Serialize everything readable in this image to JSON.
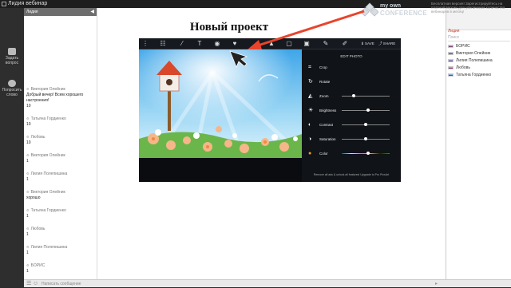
{
  "window": {
    "title": "Лидия вебинар"
  },
  "left_rail": [
    {
      "label": "Задать вопрос",
      "icon": "ask-question-icon"
    },
    {
      "label": "Попросить слово",
      "icon": "raise-hand-icon"
    }
  ],
  "chat": {
    "header": "Лидия",
    "messages": [
      {
        "author": "Виктория Олейник",
        "text": "Добрый вечер! Всем хорошего настроения!"
      },
      {
        "author": "",
        "text": "10"
      },
      {
        "author": "Татьяна Гордиенко",
        "text": "10"
      },
      {
        "author": "Любовь",
        "text": "10"
      },
      {
        "author": "Виктория Олейник",
        "text": "1"
      },
      {
        "author": "Лилия Полепишина",
        "text": "1"
      },
      {
        "author": "Виктория Олейник",
        "text": "хорошо"
      },
      {
        "author": "Татьяна Гордиенко",
        "text": "1"
      },
      {
        "author": "Любовь",
        "text": "1"
      },
      {
        "author": "Лилия Полепишина",
        "text": "1"
      },
      {
        "author": "БОРИС",
        "text": "1"
      }
    ],
    "input_placeholder": "Написать сообщение"
  },
  "stage": {
    "title": "Новый проект",
    "editor": {
      "save_label": "SAVE",
      "share_label": "SHARE",
      "panel_title": "EDIT PHOTO",
      "tools": [
        {
          "label": "Crop",
          "icon": "crop-icon"
        },
        {
          "label": "Rotate",
          "icon": "rotate-icon"
        },
        {
          "label": "Zoom",
          "icon": "zoom-icon",
          "value": 0.25
        },
        {
          "label": "Brightness",
          "icon": "brightness-icon",
          "value": 0.55
        },
        {
          "label": "Contrast",
          "icon": "contrast-icon",
          "value": 0.5
        },
        {
          "label": "Saturation",
          "icon": "saturation-icon",
          "value": 0.5
        },
        {
          "label": "Color",
          "icon": "color-icon",
          "value": 0.55
        }
      ],
      "footer": "Remove all ads & unlock all features! Upgrade to Pro PicsArt"
    }
  },
  "right_panel": {
    "selected": "Лидия",
    "search_placeholder": "Поиск",
    "users": [
      "БОРИС",
      "Виктория Олейник",
      "Лилия Полепишина",
      "Любовь",
      "Татьяна Гордиенко"
    ]
  },
  "watermark": {
    "line1": "my own",
    "line2": "CONFERENCE"
  },
  "notice": "Бесплатная версия! Зарегистрируйтесь на платной версии для увеличения количества вебинаров в месяц!"
}
